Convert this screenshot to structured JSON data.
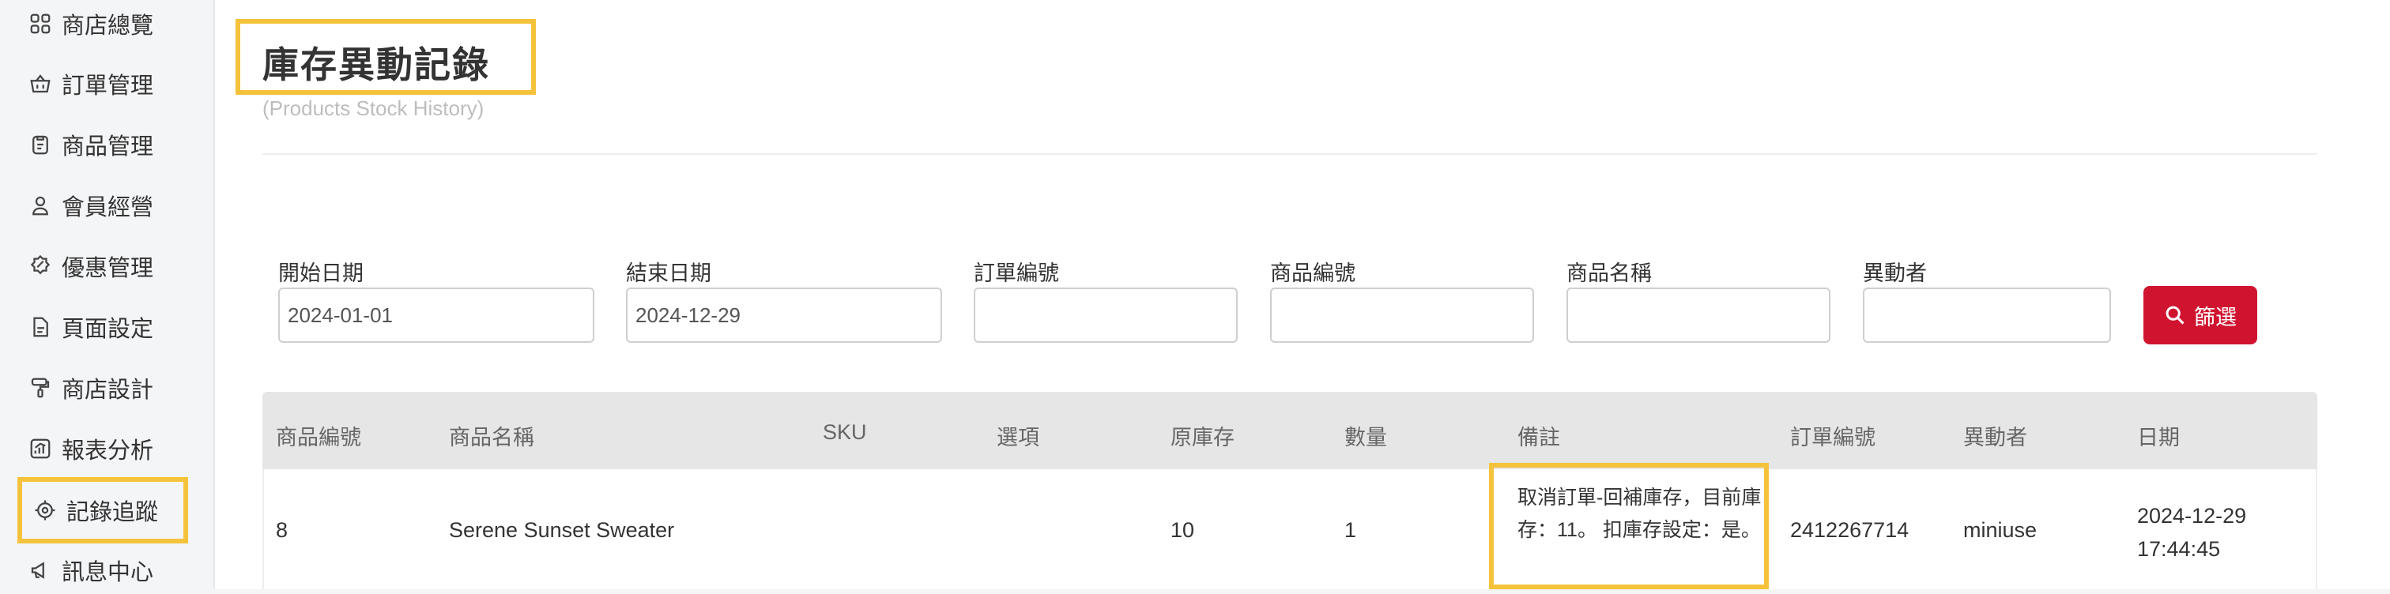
{
  "sidebar": {
    "items": [
      {
        "label": "商店總覽",
        "icon": "grid-icon"
      },
      {
        "label": "訂單管理",
        "icon": "basket-icon"
      },
      {
        "label": "商品管理",
        "icon": "clipboard-icon"
      },
      {
        "label": "會員經營",
        "icon": "user-icon"
      },
      {
        "label": "優惠管理",
        "icon": "discount-badge-icon"
      },
      {
        "label": "頁面設定",
        "icon": "page-icon"
      },
      {
        "label": "商店設計",
        "icon": "paint-roller-icon"
      },
      {
        "label": "報表分析",
        "icon": "chart-icon"
      },
      {
        "label": "記錄追蹤",
        "icon": "target-icon",
        "active": true
      },
      {
        "label": "訊息中心",
        "icon": "megaphone-icon"
      }
    ]
  },
  "header": {
    "title": "庫存異動記錄",
    "subtitle": "(Products Stock History)"
  },
  "filters": {
    "start_date_label": "開始日期",
    "start_date_value": "2024-01-01",
    "end_date_label": "結束日期",
    "end_date_value": "2024-12-29",
    "order_no_label": "訂單編號",
    "product_no_label": "商品編號",
    "product_name_label": "商品名稱",
    "operator_label": "異動者",
    "filter_button_label": "篩選"
  },
  "table": {
    "columns": [
      "商品編號",
      "商品名稱",
      "SKU",
      "選項",
      "原庫存",
      "數量",
      "備註",
      "訂單編號",
      "異動者",
      "日期"
    ],
    "rows": [
      {
        "product_no": "8",
        "product_name": "Serene Sunset Sweater",
        "sku": "",
        "option": "",
        "original_stock": "10",
        "quantity": "1",
        "note": "取消訂單-回補庫存，目前庫存：11。 扣庫存設定：是。",
        "order_no": "2412267714",
        "operator": "miniuse",
        "date": "2024-12-29",
        "time": "17:44:45"
      }
    ]
  },
  "colors": {
    "highlight": "#f5c33b",
    "primary_button": "#d0142f",
    "table_header_bg": "#e6e6e6"
  }
}
